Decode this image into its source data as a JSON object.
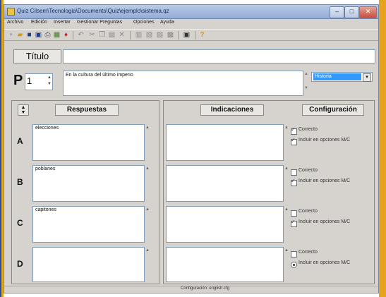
{
  "window": {
    "title": "Quiz Cilsem\\Tecnologia\\Documents\\Quiz\\ejemplo\\sistema.qz"
  },
  "menu": [
    "Archivo",
    "Edición",
    "Insertar",
    "Gestionar Preguntas",
    "Opciones",
    "Ayuda"
  ],
  "toolbar": {
    "icons": [
      "new-icon",
      "open-icon",
      "save-icon",
      "save-as-icon",
      "print-icon",
      "calculator-icon",
      "image-icon",
      "undo-icon",
      "cut-icon",
      "copy-icon",
      "paste-icon",
      "delete-icon",
      "table-icon",
      "move-up-icon",
      "move-down-icon",
      "info-icon",
      "help-icon"
    ]
  },
  "question": {
    "title_label": "Título",
    "title_value": "",
    "p_label": "P",
    "number": "1",
    "text": "En la cultura del último imperio",
    "type_selected": "Historia"
  },
  "headers": {
    "responses": "Respuestas",
    "indications": "Indicaciones",
    "config": "Configuración"
  },
  "answers": [
    {
      "letter": "A",
      "text": "elecciones",
      "indication": "",
      "correct_label": "Correcto",
      "correct": true,
      "include_label": "Incluir en opciones M/C",
      "include": true,
      "include_radio": false
    },
    {
      "letter": "B",
      "text": "poblanes",
      "indication": "",
      "correct_label": "Correcto",
      "correct": false,
      "include_label": "Incluir en opciones M/C",
      "include": true,
      "include_radio": false
    },
    {
      "letter": "C",
      "text": "capitones",
      "indication": "",
      "correct_label": "Correcto",
      "correct": false,
      "include_label": "Incluir en opciones M/C",
      "include": true,
      "include_radio": false
    },
    {
      "letter": "D",
      "text": "",
      "indication": "",
      "correct_label": "Correcto",
      "correct": false,
      "include_label": "Incluir en opciones M/C",
      "include": true,
      "include_radio": true
    }
  ],
  "status": {
    "text": "Configuración: english.cfg"
  }
}
